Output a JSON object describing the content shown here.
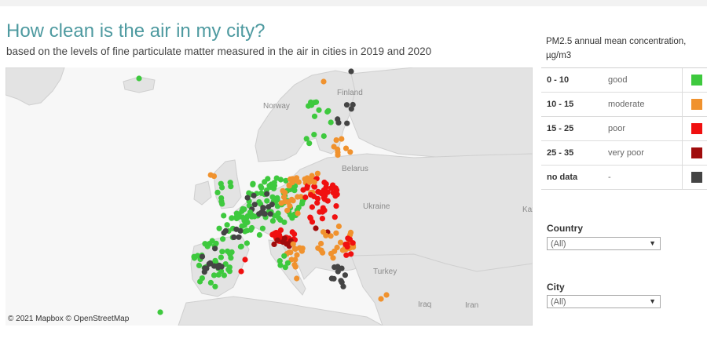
{
  "header": {
    "title": "How clean is the air in my city?",
    "subtitle": "based on the levels of fine particulate matter measured in the air in cities in 2019 and 2020"
  },
  "map": {
    "attribution": "© 2021 Mapbox  © OpenStreetMap",
    "labels": {
      "norway": "Norway",
      "finland": "Finland",
      "belarus": "Belarus",
      "ukraine": "Ukraine",
      "turkey": "Turkey",
      "iraq": "Iraq",
      "iran": "Iran",
      "kaz": "Kaz"
    },
    "colors": {
      "good": "#3ec93e",
      "moderate": "#f0922e",
      "poor": "#f01010",
      "very_poor": "#a00c0c",
      "no_data": "#444444"
    }
  },
  "legend": {
    "title": "PM2.5 annual mean concentration, µg/m3",
    "rows": [
      {
        "range": "0 - 10",
        "label": "good",
        "color": "#3ec93e"
      },
      {
        "range": "10 - 15",
        "label": "moderate",
        "color": "#f0922e"
      },
      {
        "range": "15 - 25",
        "label": "poor",
        "color": "#f01010"
      },
      {
        "range": "25 - 35",
        "label": "very poor",
        "color": "#a00c0c"
      },
      {
        "range": "no data",
        "label": "-",
        "color": "#444444"
      }
    ]
  },
  "filters": {
    "country": {
      "label": "Country",
      "value": "(All)"
    },
    "city": {
      "label": "City",
      "value": "(All)"
    }
  }
}
